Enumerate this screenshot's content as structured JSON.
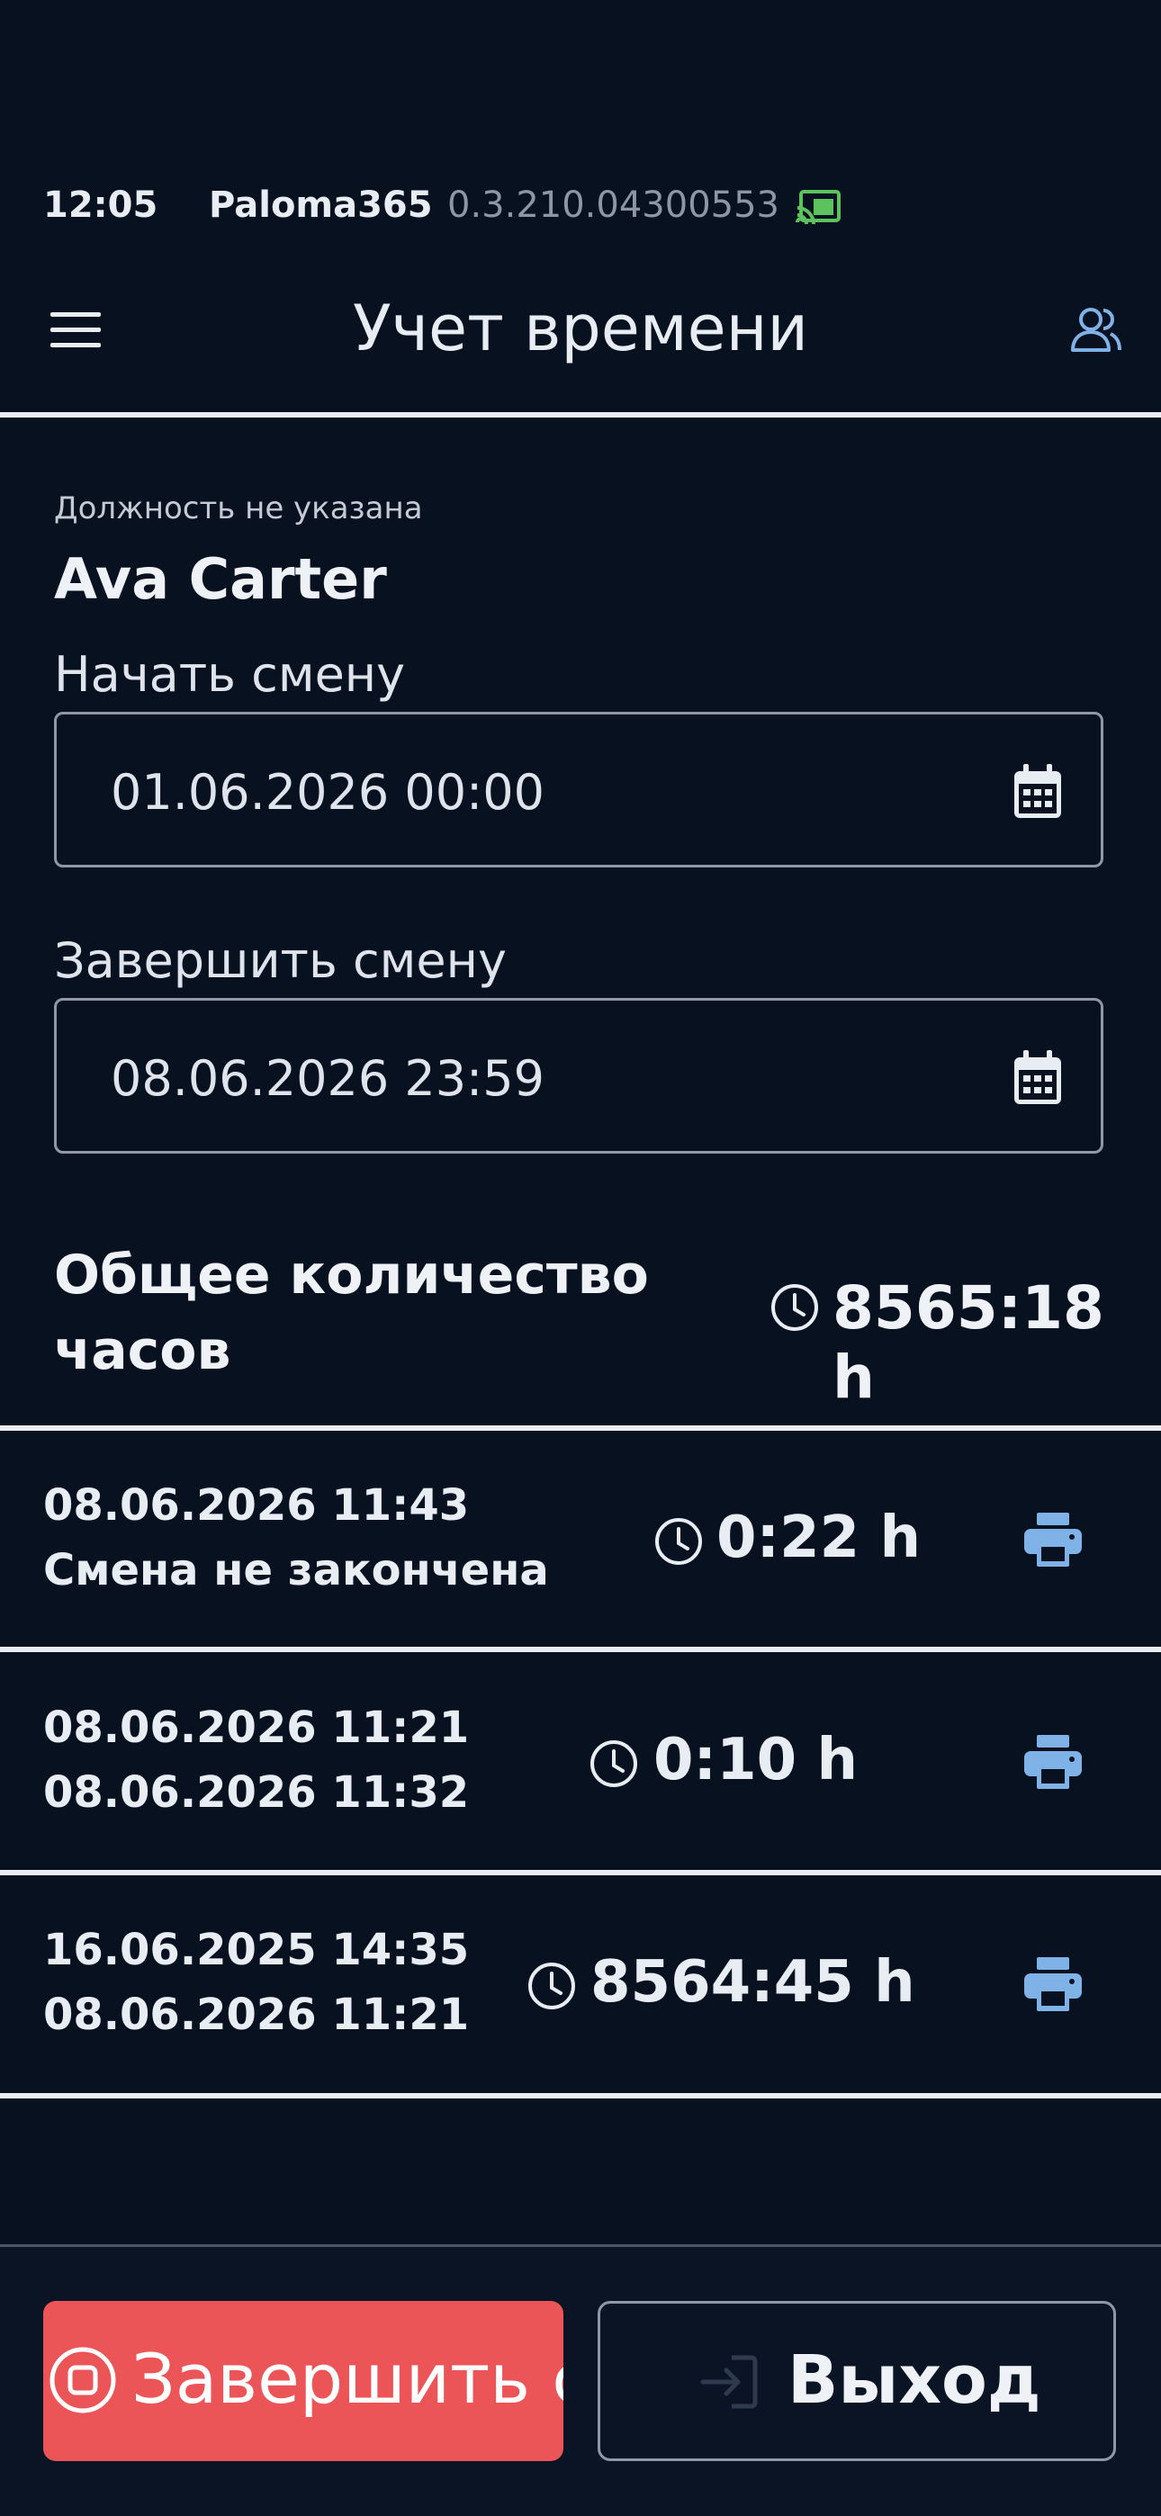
{
  "status_bar": {
    "time": "12:05",
    "app_name": "Paloma365",
    "version": "0.3.210.04300553",
    "cast_icon": "cast-icon"
  },
  "app_bar": {
    "title": "Учет времени",
    "menu_icon": "menu-icon",
    "users_icon": "users-icon"
  },
  "employee": {
    "job_title": "Должность не указана",
    "name": "Ava Carter"
  },
  "shift_start": {
    "label": "Начать смену",
    "value": "01.06.2026 00:00"
  },
  "shift_end": {
    "label": "Завершить смену",
    "value": "08.06.2026 23:59"
  },
  "total": {
    "label": "Общее количество часов",
    "value": "8565:18 h"
  },
  "shifts": [
    {
      "start": "08.06.2026 11:43",
      "end": "Смена не закончена",
      "duration": "0:22 h"
    },
    {
      "start": "08.06.2026 11:21",
      "end": "08.06.2026 11:32",
      "duration": "0:10 h"
    },
    {
      "start": "16.06.2025 14:35",
      "end": "08.06.2026 11:21",
      "duration": "8564:45 h"
    }
  ],
  "actions": {
    "end_shift_label": "Завершить смену",
    "exit_label": "Выход"
  },
  "colors": {
    "background": "#081120",
    "accent": "#7fb2e6",
    "danger": "#ec5557",
    "cast": "#5cc25e"
  }
}
